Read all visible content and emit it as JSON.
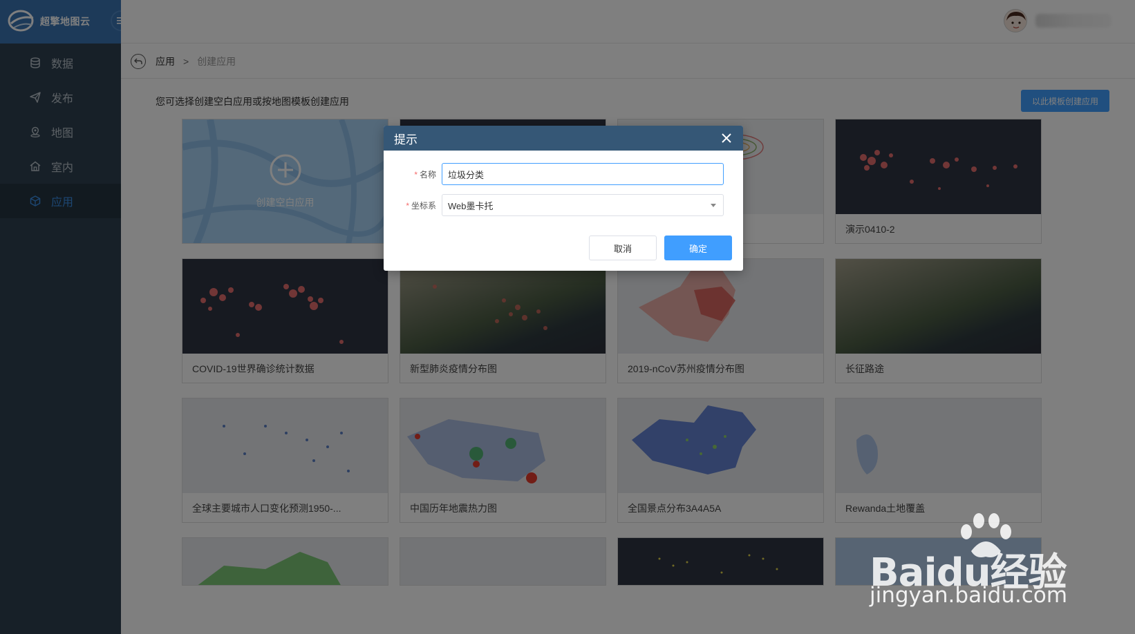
{
  "app": {
    "logo_text": "超擎地图云"
  },
  "sidebar": {
    "items": [
      {
        "label": "数据",
        "icon": "database-icon"
      },
      {
        "label": "发布",
        "icon": "send-icon"
      },
      {
        "label": "地图",
        "icon": "map-pin-icon"
      },
      {
        "label": "室内",
        "icon": "building-icon"
      },
      {
        "label": "应用",
        "icon": "cube-icon",
        "active": true
      }
    ]
  },
  "breadcrumb": {
    "parent": "应用",
    "separator": ">",
    "current": "创建应用"
  },
  "main": {
    "hint": "您可选择创建空白应用或按地图模板创建应用",
    "template_button": "以此模板创建应用",
    "blank_card_label": "创建空白应用",
    "cards": [
      {
        "label": "演示0410-2"
      },
      {
        "label": "COVID-19世界确诊统计数据"
      },
      {
        "label": "新型肺炎疫情分布图"
      },
      {
        "label": "2019-nCoV苏州疫情分布图"
      },
      {
        "label": "长征路途"
      },
      {
        "label": "全球主要城市人口变化预测1950-..."
      },
      {
        "label": "中国历年地震热力图"
      },
      {
        "label": "全国景点分布3A4A5A"
      },
      {
        "label": "Rewanda土地覆盖"
      }
    ]
  },
  "dialog": {
    "title": "提示",
    "name_label": "名称",
    "name_value": "垃圾分类",
    "crs_label": "坐标系",
    "crs_value": "Web墨卡托",
    "cancel": "取消",
    "confirm": "确定"
  },
  "watermark": {
    "main": "Baidu经验",
    "sub": "jingyan.baidu.com"
  },
  "colors": {
    "accent": "#409eff",
    "sidebar": "#2f4150",
    "logo_bar": "#3b74b3",
    "dialog_header": "#355776"
  }
}
